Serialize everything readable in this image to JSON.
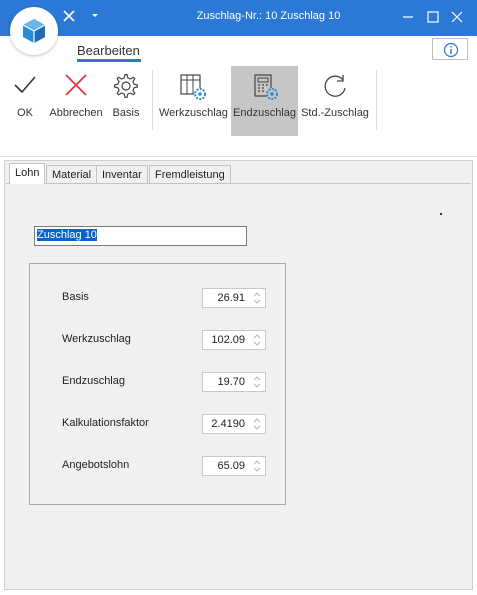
{
  "window": {
    "title": "Zuschlag-Nr.: 10 Zuschlag 10"
  },
  "ribbon": {
    "tab_label": "Bearbeiten",
    "buttons": [
      {
        "label": "OK",
        "icon": "checkmark-icon"
      },
      {
        "label": "Abbrechen",
        "icon": "close-x-icon"
      },
      {
        "label": "Basis",
        "icon": "gear-icon"
      },
      {
        "label": "Werkzuschlag",
        "icon": "table-gear-icon"
      },
      {
        "label": "Endzuschlag",
        "icon": "calculator-gear-icon"
      },
      {
        "label": "Std.-Zuschlag",
        "icon": "refresh-icon"
      }
    ],
    "active_button": "Endzuschlag"
  },
  "tabs": [
    "Lohn",
    "Material",
    "Inventar",
    "Fremdleistung"
  ],
  "active_tab": "Lohn",
  "form": {
    "name_value": "Zuschlag 10",
    "fields": [
      {
        "label": "Basis",
        "value": "26.91"
      },
      {
        "label": "Werkzuschlag",
        "value": "102.09"
      },
      {
        "label": "Endzuschlag",
        "value": "19.70"
      },
      {
        "label": "Kalkulationsfaktor",
        "value": "2.4190"
      },
      {
        "label": "Angebotslohn",
        "value": "65.09"
      }
    ]
  },
  "colors": {
    "titlebar": "#2b78d6",
    "active_button_bg": "#c6c6c6",
    "selection": "#0a64c8",
    "cancel_red": "#e8323c",
    "gear_blue": "#2b8ad6"
  }
}
